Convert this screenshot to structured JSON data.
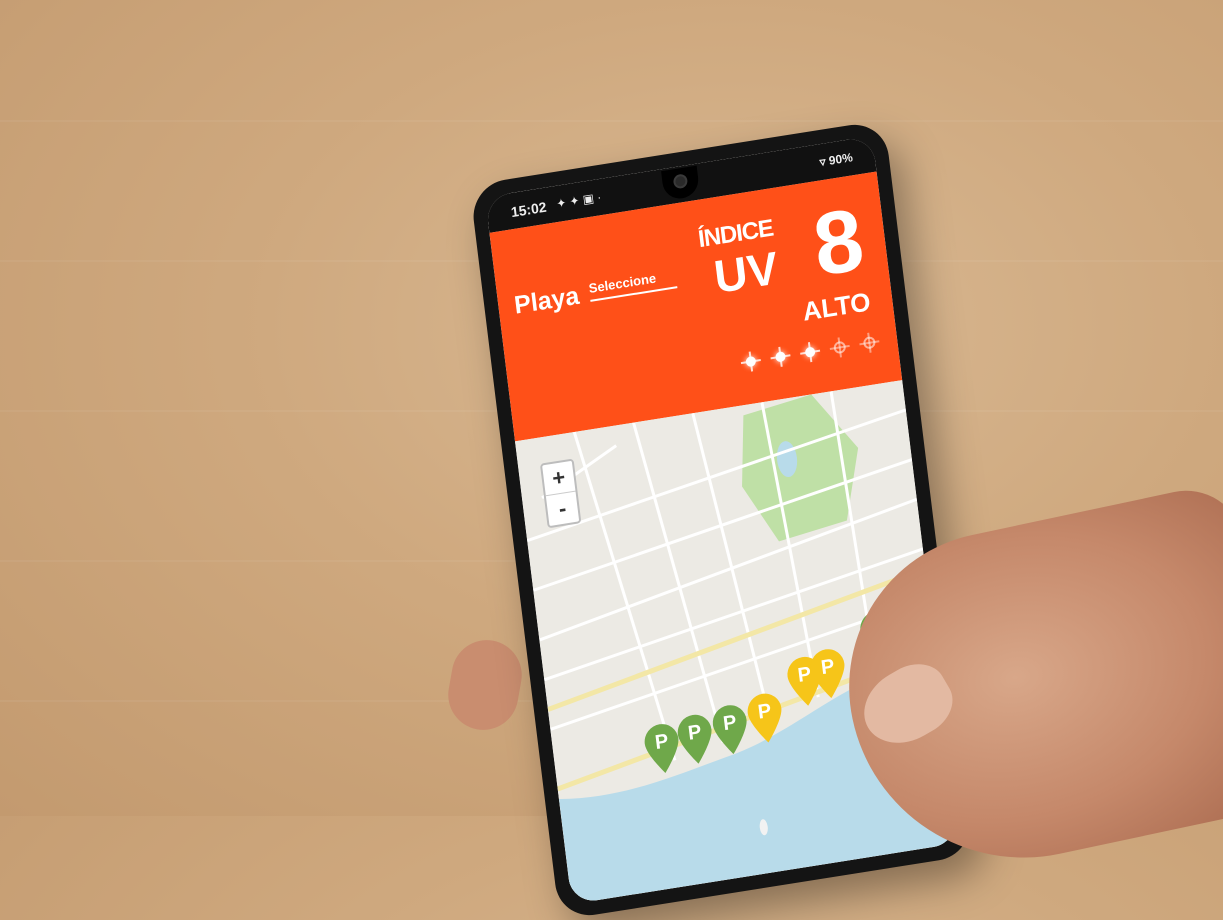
{
  "status_bar": {
    "time": "15:02",
    "icons": "✦ ✦ ▣ ·",
    "battery": "▿ 90%"
  },
  "header": {
    "beach_label": "Playa",
    "select_text": "Seleccione",
    "uv_word_1": "ÍNDICE",
    "uv_word_2": "UV",
    "uv_value": "8",
    "uv_level": "ALTO",
    "uv_suns": {
      "filled": 3,
      "total": 5
    }
  },
  "map": {
    "zoom_in": "+",
    "zoom_out": "-",
    "pins": [
      {
        "label": "P",
        "color": "#6fa84a"
      },
      {
        "label": "P",
        "color": "#6fa84a"
      },
      {
        "label": "P",
        "color": "#6fa84a"
      },
      {
        "label": "P",
        "color": "#f6c519"
      },
      {
        "label": "P",
        "color": "#f6c519"
      },
      {
        "label": "P",
        "color": "#f6c519"
      },
      {
        "label": "P",
        "color": "#6fa84a"
      }
    ]
  },
  "colors": {
    "accent": "#ff5018",
    "water": "#b8dbea",
    "park": "#bfe0a6"
  }
}
